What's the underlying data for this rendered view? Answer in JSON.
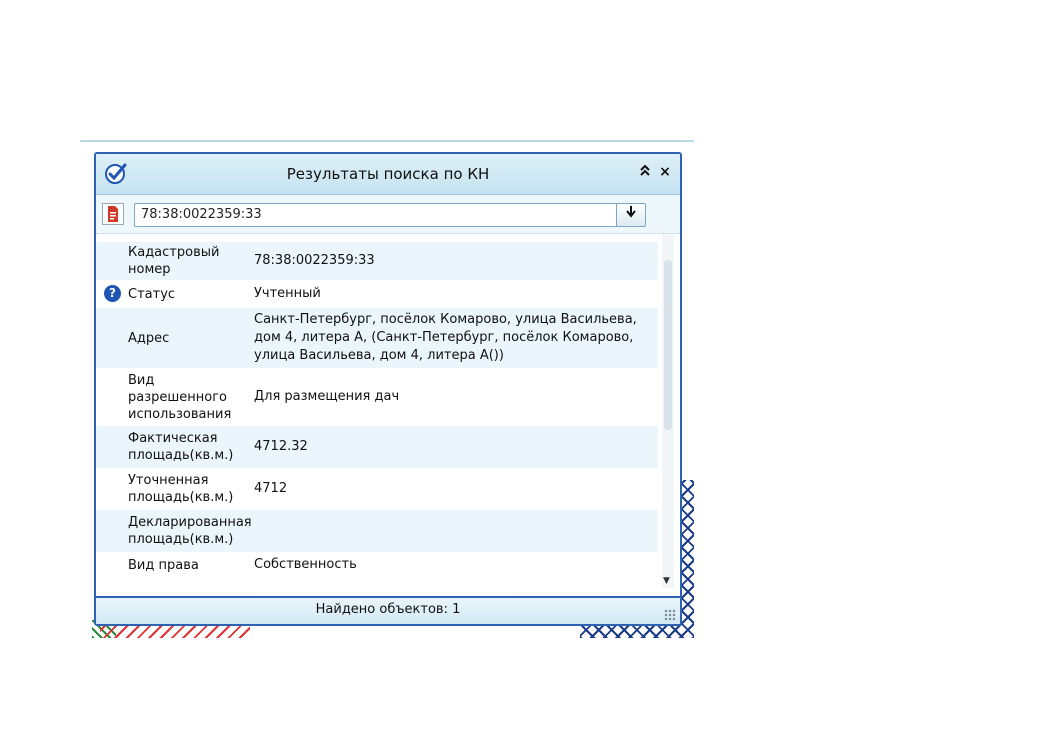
{
  "window": {
    "title": "Результаты поиска по КН",
    "collapse_glyph": "⌃",
    "close_glyph": "×"
  },
  "search": {
    "value": "78:38:0022359:33",
    "dropdown_glyph": "▾"
  },
  "properties": [
    {
      "label": "Кадастровый номер",
      "value": "78:38:0022359:33",
      "icon": ""
    },
    {
      "label": "Статус",
      "value": "Учтенный",
      "icon": "help-icon"
    },
    {
      "label": "Адрес",
      "value": "Санкт-Петербург, посёлок Комарово, улица Васильева, дом 4, литера А, (Санкт-Петербург, посёлок Комарово, улица Васильева, дом 4, литера А())",
      "icon": ""
    },
    {
      "label": "Вид разрешенного использования",
      "value": "Для размещения дач",
      "icon": ""
    },
    {
      "label": "Фактическая площадь(кв.м.)",
      "value": "4712.32",
      "icon": ""
    },
    {
      "label": "Уточненная площадь(кв.м.)",
      "value": "4712",
      "icon": ""
    },
    {
      "label": "Декларированная площадь(кв.м.)",
      "value": "",
      "icon": ""
    },
    {
      "label": "Вид права",
      "value": "Собственность",
      "icon": ""
    }
  ],
  "status": {
    "text": "Найдено объектов: 1"
  },
  "colors": {
    "frame": "#2f63b1",
    "row_alt": "#eaf6fb",
    "titlebar": "#c4e2f0",
    "pdf_red": "#d03a2a"
  }
}
